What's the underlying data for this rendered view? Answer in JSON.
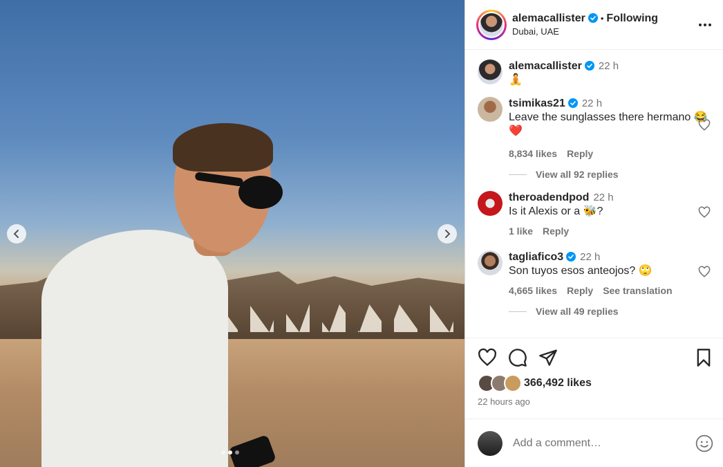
{
  "post": {
    "username": "alemacallister",
    "follow_status": "Following",
    "separator": "•",
    "location": "Dubai, UAE",
    "caption_time": "22 h",
    "caption": "🧘",
    "carousel_count": 3,
    "carousel_active_index": 1
  },
  "comments": [
    {
      "user": "tsimikas21",
      "verified": true,
      "time": "22 h",
      "text": "Leave the sunglasses there hermano 😂❤️",
      "likes": "8,834 likes",
      "reply": "Reply",
      "view_replies": "View all 92 replies"
    },
    {
      "user": "theroadendpod",
      "verified": false,
      "time": "22 h",
      "text": "Is it Alexis or a 🐝?",
      "likes": "1 like",
      "reply": "Reply"
    },
    {
      "user": "tagliafico3",
      "verified": true,
      "time": "22 h",
      "text": "Son tuyos esos anteojos? 🙄",
      "likes": "4,665 likes",
      "reply": "Reply",
      "translate": "See translation",
      "view_replies": "View all 49 replies"
    }
  ],
  "footer": {
    "likes": "366,492 likes",
    "time_ago": "22 hours ago",
    "add_comment_placeholder": "Add a comment…"
  },
  "colors": {
    "verified": "#0095f6",
    "text": "#262626",
    "muted": "#737373"
  }
}
